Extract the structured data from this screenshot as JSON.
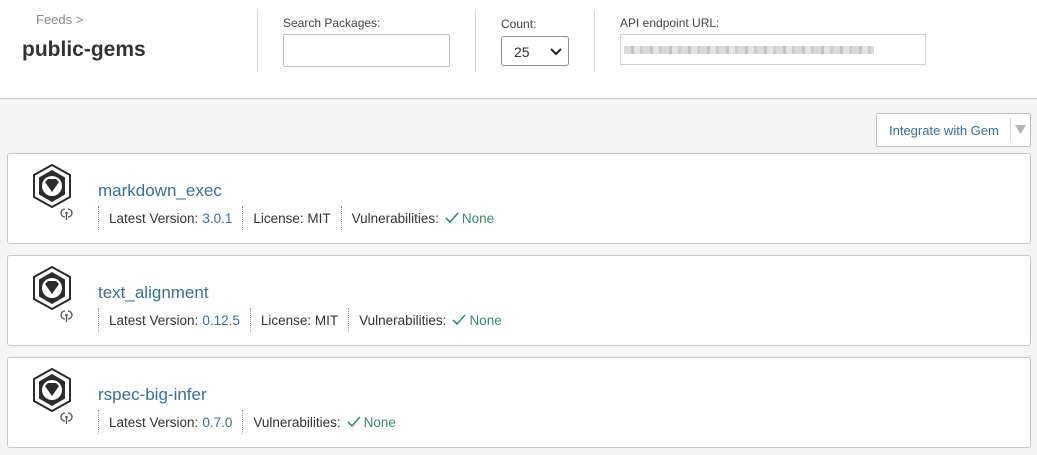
{
  "header": {
    "breadcrumb": "Feeds >",
    "title": "public-gems",
    "search_label": "Search Packages:",
    "search_value": "",
    "search_placeholder": "",
    "count_label": "Count:",
    "count_value": "25",
    "endpoint_label": "API endpoint URL:"
  },
  "toolbar": {
    "integrate_label": "Integrate with Gem"
  },
  "packages": [
    {
      "name": "markdown_exec",
      "version_label": "Latest Version:",
      "version": "3.0.1",
      "license": "License: MIT",
      "vuln_label": "Vulnerabilities:",
      "vuln_status": "None"
    },
    {
      "name": "text_alignment",
      "version_label": "Latest Version:",
      "version": "0.12.5",
      "license": "License: MIT",
      "vuln_label": "Vulnerabilities:",
      "vuln_status": "None"
    },
    {
      "name": "rspec-big-infer",
      "version_label": "Latest Version:",
      "version": "0.7.0",
      "vuln_label": "Vulnerabilities:",
      "vuln_status": "None"
    }
  ],
  "colors": {
    "link": "#3a6f97",
    "success": "#3a8a6a",
    "icon_dark": "#2b2b2b"
  },
  "icons": {
    "package": "gem-package-icon",
    "status": "check-icon",
    "dropdown": "caret-down-icon"
  }
}
